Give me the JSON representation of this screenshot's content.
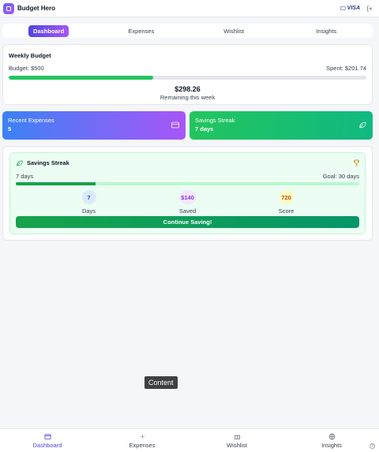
{
  "app": {
    "title": "Budget Hero",
    "card_brand": "VISA"
  },
  "tabs": [
    {
      "label": "Dashboard",
      "active": true
    },
    {
      "label": "Expenses",
      "active": false
    },
    {
      "label": "Wishlist",
      "active": false
    },
    {
      "label": "Insights",
      "active": false
    }
  ],
  "weekly_budget": {
    "title": "Weekly Budget",
    "budget_label": "Budget: $500",
    "spent_label": "Spent: $201.74",
    "progress_percent": 40.3,
    "remaining_value": "$298.26",
    "remaining_label": "Remaining this week"
  },
  "tiles": {
    "expenses": {
      "label": "Recent Expenses",
      "value": "5",
      "icon": "credit-card-icon"
    },
    "streak": {
      "label": "Savings Streak",
      "value": "7 days",
      "icon": "leaf-icon"
    }
  },
  "streak_card": {
    "title": "Savings Streak",
    "current": "7 days",
    "goal": "Goal: 30 days",
    "progress_percent": 23.3,
    "stats": {
      "days": {
        "value": "7",
        "label": "Days"
      },
      "saved": {
        "value": "$140",
        "label": "Saved"
      },
      "score": {
        "value": "720",
        "label": "Score"
      }
    },
    "button_label": "Continue Saving!"
  },
  "tooltip": "Content",
  "bottom_nav": [
    {
      "label": "Dashboard",
      "icon": "wallet-icon",
      "active": true
    },
    {
      "label": "Expenses",
      "icon": "plus-icon",
      "active": false
    },
    {
      "label": "Wishlist",
      "icon": "gift-icon",
      "active": false
    },
    {
      "label": "Insights",
      "icon": "globe-icon",
      "active": false
    }
  ],
  "help": "?",
  "colors": {
    "accent": "#4f46e5",
    "success": "#22c55e",
    "purple": "#a855f7"
  }
}
